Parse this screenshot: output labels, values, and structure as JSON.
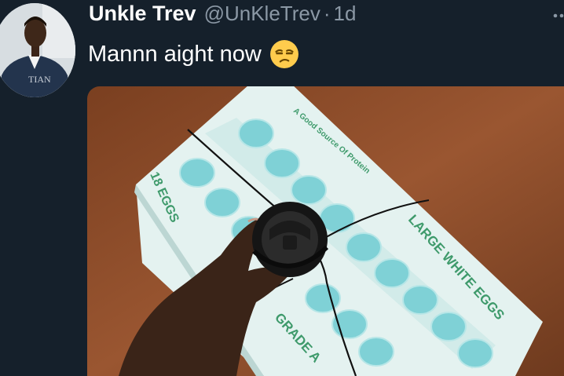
{
  "tweet": {
    "display_name": "Unkle Trev",
    "handle": "@UnKleTrev",
    "separator": "·",
    "timestamp": "1d",
    "text": "Mannn aight now",
    "emoji": "unamused-face-emoji"
  },
  "avatar": {
    "shirt_text": "TIAN"
  },
  "media": {
    "carton_labels": {
      "count": "18 EGGS",
      "protein": "A Good Source Of Protein",
      "type": "LARGE WHITE EGGS",
      "grade": "GRADE A"
    }
  },
  "colors": {
    "background": "#15202b",
    "name": "#ffffff",
    "secondary": "#8b98a5",
    "carton": "#cfeae8",
    "carton_print": "#3e9a6b",
    "table": "#8a4a26"
  }
}
